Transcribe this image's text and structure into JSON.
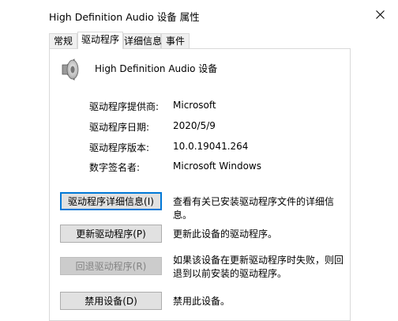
{
  "window": {
    "title": "High Definition Audio 设备 属性",
    "close_glyph": "✕"
  },
  "tabs": [
    {
      "label": "常规",
      "active": false
    },
    {
      "label": "驱动程序",
      "active": true
    },
    {
      "label": "详细信息",
      "active": false
    },
    {
      "label": "事件",
      "active": false
    }
  ],
  "device": {
    "name": "High Definition Audio 设备",
    "icon": "speaker-icon"
  },
  "info": [
    {
      "label": "驱动程序提供商:",
      "value": "Microsoft"
    },
    {
      "label": "驱动程序日期:",
      "value": "2020/5/9"
    },
    {
      "label": "驱动程序版本:",
      "value": "10.0.19041.264"
    },
    {
      "label": "数字签名者:",
      "value": "Microsoft Windows"
    }
  ],
  "buttons": [
    {
      "label": "驱动程序详细信息(I)",
      "description": "查看有关已安装驱动程序文件的详细信息。",
      "state": "focused"
    },
    {
      "label": "更新驱动程序(P)",
      "description": "更新此设备的驱动程序。",
      "state": "normal"
    },
    {
      "label": "回退驱动程序(R)",
      "description": "如果该设备在更新驱动程序时失败，则回退到以前安装的驱动程序。",
      "state": "disabled"
    },
    {
      "label": "禁用设备(D)",
      "description": "禁用此设备。",
      "state": "normal"
    }
  ],
  "colors": {
    "focus_border": "#0078d7",
    "button_face": "#e1e1e1",
    "disabled_face": "#cccccc"
  }
}
